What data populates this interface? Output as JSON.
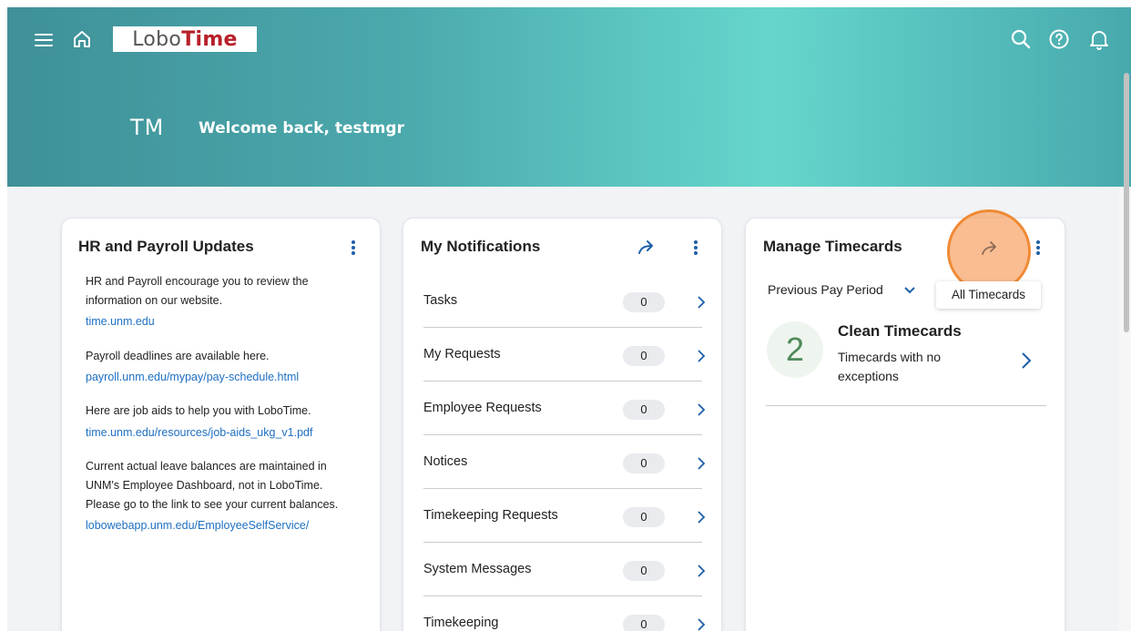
{
  "header": {
    "logo_lobo": "Lobo",
    "logo_time": "Time",
    "initials": "TM",
    "welcome": "Welcome back, testmgr"
  },
  "hr_card": {
    "title": "HR and Payroll Updates",
    "items": [
      {
        "text": "HR and Payroll encourage you to review the information on our website.",
        "link": "time.unm.edu"
      },
      {
        "text": "Payroll deadlines are available here.",
        "link": "payroll.unm.edu/mypay/pay-schedule.html"
      },
      {
        "text": "Here are job aids to help you with LoboTime.",
        "link": "time.unm.edu/resources/job-aids_ukg_v1.pdf"
      },
      {
        "text": "Current actual leave balances are maintained in UNM's Employee Dashboard, not in LoboTime. Please go to the link to see your current balances.",
        "link": "lobowebapp.unm.edu/EmployeeSelfService/"
      }
    ]
  },
  "notifications_card": {
    "title": "My Notifications",
    "rows": [
      {
        "label": "Tasks",
        "count": "0"
      },
      {
        "label": "My Requests",
        "count": "0"
      },
      {
        "label": "Employee Requests",
        "count": "0"
      },
      {
        "label": "Notices",
        "count": "0"
      },
      {
        "label": "Timekeeping Requests",
        "count": "0"
      },
      {
        "label": "System Messages",
        "count": "0"
      },
      {
        "label": "Timekeeping",
        "count": "0"
      }
    ]
  },
  "timecards_card": {
    "title": "Manage Timecards",
    "period": "Previous Pay Period",
    "tooltip": "All Timecards",
    "summary_count": "2",
    "summary_title": "Clean Timecards",
    "summary_desc": "Timecards with no exceptions"
  },
  "colors": {
    "accent": "#1d5fa8",
    "link": "#1e6fc2",
    "logo_red": "#b8202a",
    "highlight": "#f08a35",
    "count_green": "#4f8a5b"
  }
}
